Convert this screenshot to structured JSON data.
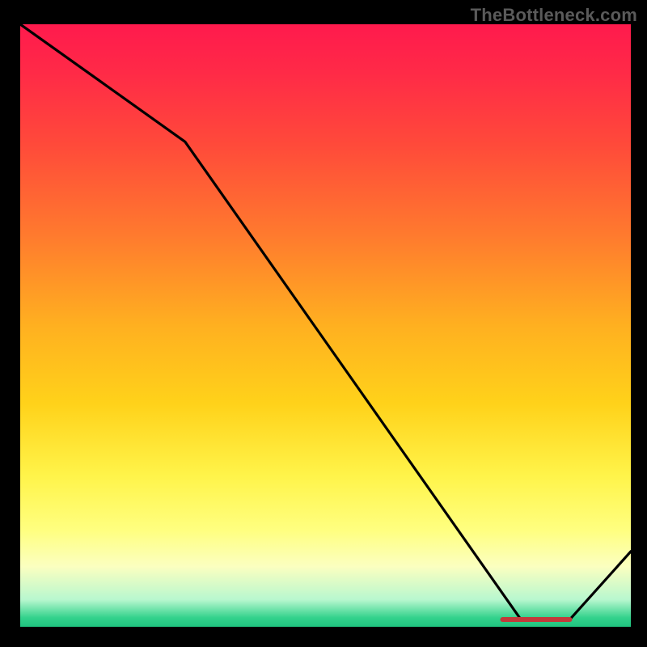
{
  "attribution": "TheBottleneck.com",
  "colors": {
    "page_bg": "#000000",
    "frame": "#000000",
    "line": "#000000",
    "marker": "#c23a3a",
    "gradient_stops": [
      {
        "offset": 0.0,
        "color": "#ff1a4d"
      },
      {
        "offset": 0.08,
        "color": "#ff2a47"
      },
      {
        "offset": 0.2,
        "color": "#ff4a3a"
      },
      {
        "offset": 0.35,
        "color": "#ff7a2e"
      },
      {
        "offset": 0.5,
        "color": "#ffb020"
      },
      {
        "offset": 0.63,
        "color": "#ffd21a"
      },
      {
        "offset": 0.75,
        "color": "#fff44a"
      },
      {
        "offset": 0.84,
        "color": "#ffff80"
      },
      {
        "offset": 0.9,
        "color": "#fbffc0"
      },
      {
        "offset": 0.955,
        "color": "#b8f7cf"
      },
      {
        "offset": 0.985,
        "color": "#33d28c"
      },
      {
        "offset": 1.0,
        "color": "#1fc37f"
      }
    ]
  },
  "chart_data": {
    "type": "line",
    "title": "",
    "xlabel": "",
    "ylabel": "",
    "xlim": [
      0,
      100
    ],
    "ylim": [
      0,
      100
    ],
    "grid": false,
    "legend": false,
    "series": [
      {
        "name": "bottleneck-curve",
        "x": [
          0,
          27,
          82,
          90,
          100
        ],
        "values": [
          100,
          80.5,
          1.2,
          1.2,
          12.5
        ]
      }
    ],
    "annotations": [
      {
        "type": "flat-minimum-marker",
        "x_start": 79,
        "x_end": 90,
        "y": 1.2
      }
    ]
  }
}
